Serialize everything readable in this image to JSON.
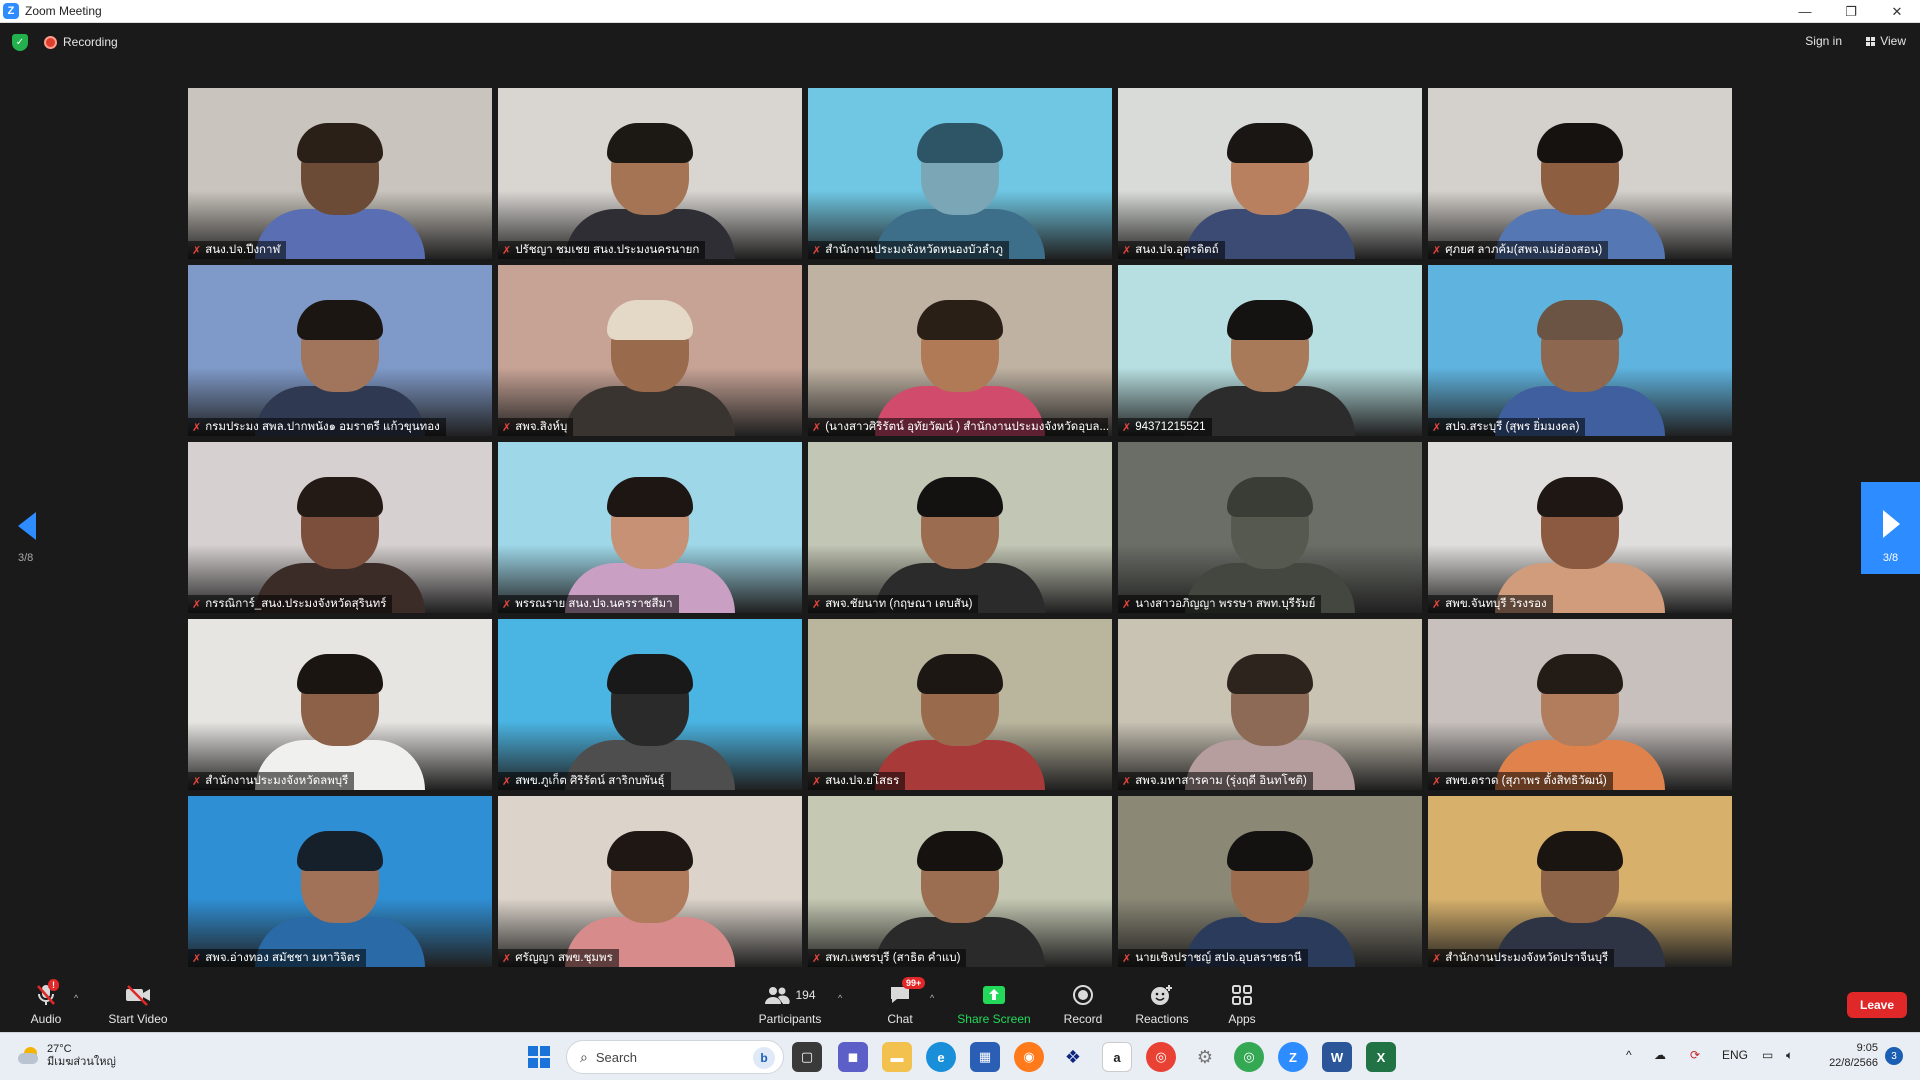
{
  "window": {
    "title": "Zoom Meeting",
    "minimize": "—",
    "maximize": "❐",
    "close": "✕"
  },
  "topbar": {
    "recording": "Recording",
    "sign_in": "Sign in",
    "view": "View"
  },
  "gallery": {
    "page_left": "3/8",
    "page_right": "3/8",
    "tiles": [
      {
        "name": "สนง.ปจ.ปีงกาฬ",
        "bg": "#c9c4bd",
        "skin": "#6b4a36",
        "shirt": "#5a6fb3",
        "hair": "#2a2018"
      },
      {
        "name": "ปรัชญา ชมเชย สนง.ประมงนครนายก",
        "bg": "#d9d6d2",
        "skin": "#a57454",
        "shirt": "#2e2e34",
        "hair": "#1c1915"
      },
      {
        "name": "สำนักงานประมงจังหวัดหนองบัวลำภู",
        "bg": "#6fc7e3",
        "skin": "#7aa6b5",
        "shirt": "#3d6f8a",
        "hair": "#2d5566"
      },
      {
        "name": "สนง.ปจ.อุตรดิตถ์",
        "bg": "#d8dbd7",
        "skin": "#b98060",
        "shirt": "#3b4b73",
        "hair": "#1a1613"
      },
      {
        "name": "ศุภยศ ลาภค้ม(สพจ.แม่ฮ่องสอน)",
        "bg": "#d4d0cb",
        "skin": "#8e5e41",
        "shirt": "#5577b3",
        "hair": "#16120f"
      },
      {
        "name": "กรมประมง สพล.ปากพนัง๑ อมราตรี แก้วขุนทอง",
        "bg": "#7f9ac9",
        "skin": "#a0755b",
        "shirt": "#2f3a52",
        "hair": "#1b1612"
      },
      {
        "name": "สพจ.สิงห์บุ",
        "bg": "#c7a396",
        "skin": "#9a6a4d",
        "shirt": "#3a3430",
        "hair": "#e4d9c6"
      },
      {
        "name": "(นางสาวศิริรัตน์ อุทัยวัฒน์ ) สำนักงานประมงจังหวัดอุบล...",
        "bg": "#bfb2a2",
        "skin": "#b07a56",
        "shirt": "#d14b6d",
        "hair": "#2a1f16"
      },
      {
        "name": "94371215521",
        "bg": "#b7dfe1",
        "skin": "#a87a5a",
        "shirt": "#2c2c2c",
        "hair": "#151311"
      },
      {
        "name": "สปจ.สระบุรี (สุพร ยิ่มมงคล)",
        "bg": "#5fb3df",
        "skin": "#8e6750",
        "shirt": "#3f5f9f",
        "hair": "#6c5444"
      },
      {
        "name": "กรรณิการ์_สนง.ประมงจังหวัดสุรินทร์",
        "bg": "#d6d0d0",
        "skin": "#7b4f3c",
        "shirt": "#3b2c28",
        "hair": "#231a16"
      },
      {
        "name": "พรรณราย สนง.ปจ.นครราชสีมา",
        "bg": "#9ed7e8",
        "skin": "#c69174",
        "shirt": "#c9a0c4",
        "hair": "#1d1613"
      },
      {
        "name": "สพจ.ชัยนาท (กฤษณา เตบสัน)",
        "bg": "#c2c6b4",
        "skin": "#9b6c4f",
        "shirt": "#2b2b2b",
        "hair": "#141210"
      },
      {
        "name": "นางสาวอภิญญา พรรษา สพท.บุรีรัมย์",
        "bg": "#6a6e66",
        "skin": "#55594f",
        "shirt": "#44473f",
        "hair": "#3a3c36"
      },
      {
        "name": "สพข.จันทบุรี วิรงรอง",
        "bg": "#e0dedc",
        "skin": "#8c5a40",
        "shirt": "#d19c7c",
        "hair": "#1e1713"
      },
      {
        "name": "สำนักงานประมงจังหวัดลพบุรี",
        "bg": "#e7e5e2",
        "skin": "#8d6147",
        "shirt": "#f0f0ee",
        "hair": "#1b1511"
      },
      {
        "name": "สพข.ภูเก็ต ศิริรัตน์ สาริกบพันธุ์",
        "bg": "#4ab4e2",
        "skin": "#2a2a2a",
        "shirt": "#4e4e4e",
        "hair": "#191919"
      },
      {
        "name": "สนง.ปจ.ยโสธร",
        "bg": "#bab59d",
        "skin": "#9a6a4d",
        "shirt": "#a83a3a",
        "hair": "#1c1713"
      },
      {
        "name": "สพจ.มหาสารคาม (รุ่งฤดี อินทโชติ)",
        "bg": "#c9c3b4",
        "skin": "#8c6a55",
        "shirt": "#b79e9e",
        "hair": "#2d241d"
      },
      {
        "name": "สพข.ตราด (สุภาพร ตั้งสิทธิวัฒน์)",
        "bg": "#c7c0bd",
        "skin": "#b27d5d",
        "shirt": "#e0824b",
        "hair": "#231b16"
      },
      {
        "name": "สพจ.อ่างทอง สมัชชา มหาวิจิตร",
        "bg": "#2f8fd4",
        "skin": "#a17257",
        "shirt": "#2a6aa6",
        "hair": "#16202a"
      },
      {
        "name": "ศรัญญา สพข.ชุมพร",
        "bg": "#dcd4cb",
        "skin": "#b07a5c",
        "shirt": "#d78b8b",
        "hair": "#1e1713"
      },
      {
        "name": "สพภ.เพชรบุรี (สาธิต คำแบ)",
        "bg": "#c5c9b3",
        "skin": "#9b6e52",
        "shirt": "#2a2a2a",
        "hair": "#151210"
      },
      {
        "name": "นายเชิงปราชญ์ สปจ.อุบลราชธานี",
        "bg": "#8b8876",
        "skin": "#9c6c4e",
        "shirt": "#2b3b5c",
        "hair": "#141210"
      },
      {
        "name": "สำนักงานประมงจังหวัดปราจีนบุรี",
        "bg": "#d7b16c",
        "skin": "#8e6448",
        "shirt": "#2f3445",
        "hair": "#1a1511"
      }
    ]
  },
  "toolbar": {
    "audio": "Audio",
    "audio_alert": "!",
    "start_video": "Start Video",
    "participants_count": "194",
    "participants": "Participants",
    "chat_badge": "99+",
    "chat": "Chat",
    "share_screen": "Share Screen",
    "record": "Record",
    "reactions": "Reactions",
    "apps": "Apps",
    "leave": "Leave"
  },
  "taskbar": {
    "temperature": "27°C",
    "weather_desc": "มีเมฆส่วนใหญ่",
    "search": "Search",
    "language": "ENG",
    "time": "9:05",
    "date": "22/8/2566",
    "notifications": "3"
  },
  "colors": {
    "zoom_blue": "#2d8cff",
    "leave_red": "#e02828",
    "share_green": "#23d959",
    "muted_mic": "#e8453c"
  }
}
